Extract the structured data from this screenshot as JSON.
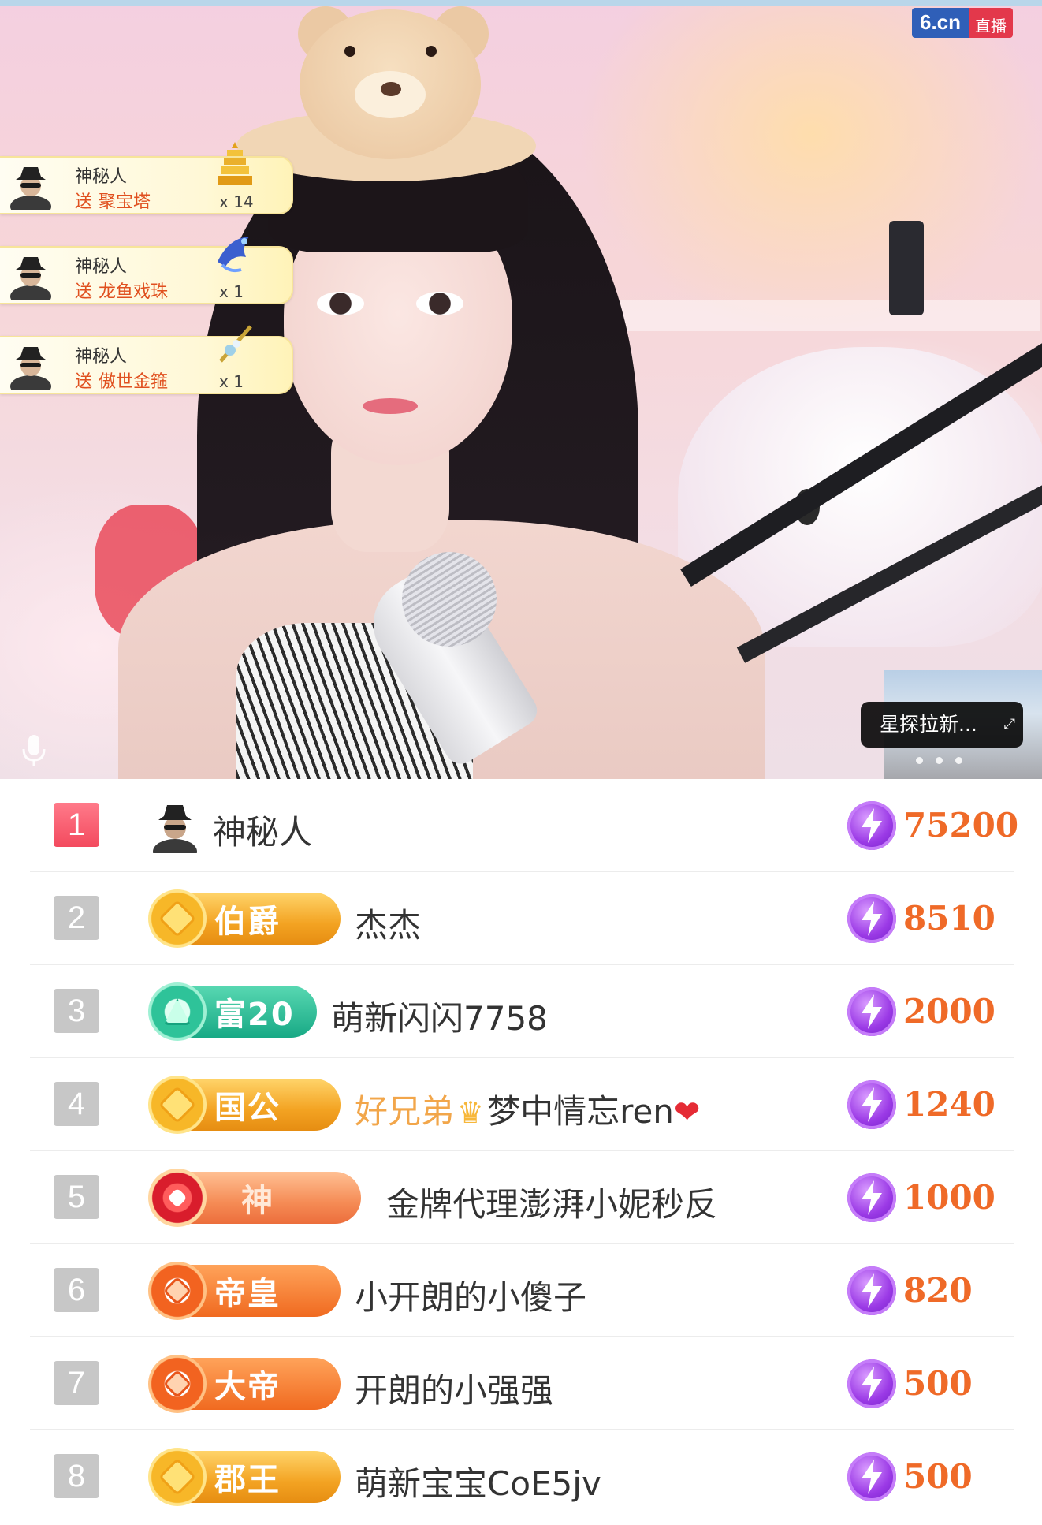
{
  "app": {
    "logo_domain": "6.cn",
    "logo_live": "直播"
  },
  "gift_notifications": [
    {
      "user": "神秘人",
      "action": "送",
      "gift": "聚宝塔",
      "count": "x 14",
      "gift_icon": "pagoda-icon"
    },
    {
      "user": "神秘人",
      "action": "送",
      "gift": "龙鱼戏珠",
      "count": "x 1",
      "gift_icon": "dragon-fish-icon"
    },
    {
      "user": "神秘人",
      "action": "送",
      "gift": "傲世金箍",
      "count": "x 1",
      "gift_icon": "golden-staff-icon"
    }
  ],
  "mini_player": {
    "title": "星探拉新..."
  },
  "ranking": [
    {
      "rank": "1",
      "badge": null,
      "user": "神秘人",
      "amount": "75200"
    },
    {
      "rank": "2",
      "badge": "伯爵",
      "user": "杰杰",
      "amount": "8510"
    },
    {
      "rank": "3",
      "badge": "富20",
      "user": "萌新闪闪7758",
      "amount": "2000"
    },
    {
      "rank": "4",
      "badge": "国公",
      "user_prefix": "好兄弟",
      "user": "梦中情忘ren",
      "amount": "1240"
    },
    {
      "rank": "5",
      "badge": "神",
      "user": "金牌代理澎湃小妮秒反",
      "amount": "1000"
    },
    {
      "rank": "6",
      "badge": "帝皇",
      "user": "小开朗的小傻子",
      "amount": "820"
    },
    {
      "rank": "7",
      "badge": "大帝",
      "user": "开朗的小强强",
      "amount": "500"
    },
    {
      "rank": "8",
      "badge": "郡王",
      "user": "萌新宝宝CoE5jv",
      "amount": "500"
    }
  ],
  "colors": {
    "amount": "#ef6a28",
    "rank1": "#f34a5e",
    "coin": "#9b3ae6"
  }
}
